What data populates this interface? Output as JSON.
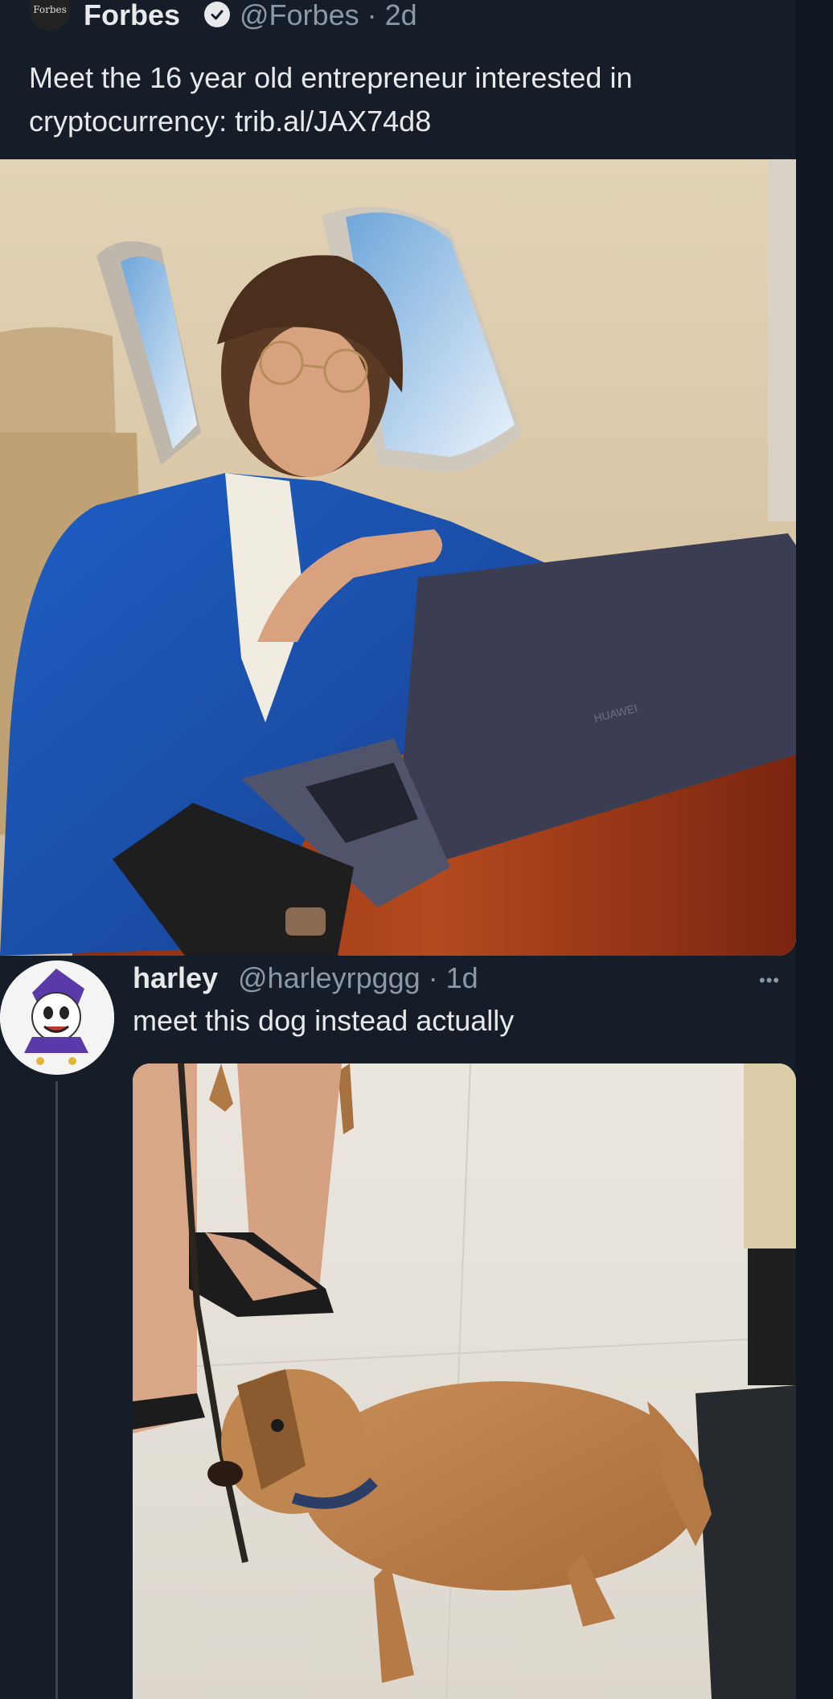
{
  "tweet1": {
    "avatar_text": "Forbes",
    "name": "Forbes",
    "handle_time": "@Forbes · 2d",
    "text": "Meet the 16 year old entrepreneur interested in cryptocurrency: trib.al/JAX74d8",
    "media": {
      "laptop_brand": "HUAWEI"
    }
  },
  "tweet2": {
    "name": "harley",
    "handle_time": "@harleyrpggg · 1d",
    "text": "meet this dog instead actually",
    "more_label": "•••"
  },
  "colors": {
    "background": "#151d28",
    "text_primary": "#e7e9ea",
    "text_secondary": "#8b98a5",
    "thread_line": "#3a4553"
  }
}
